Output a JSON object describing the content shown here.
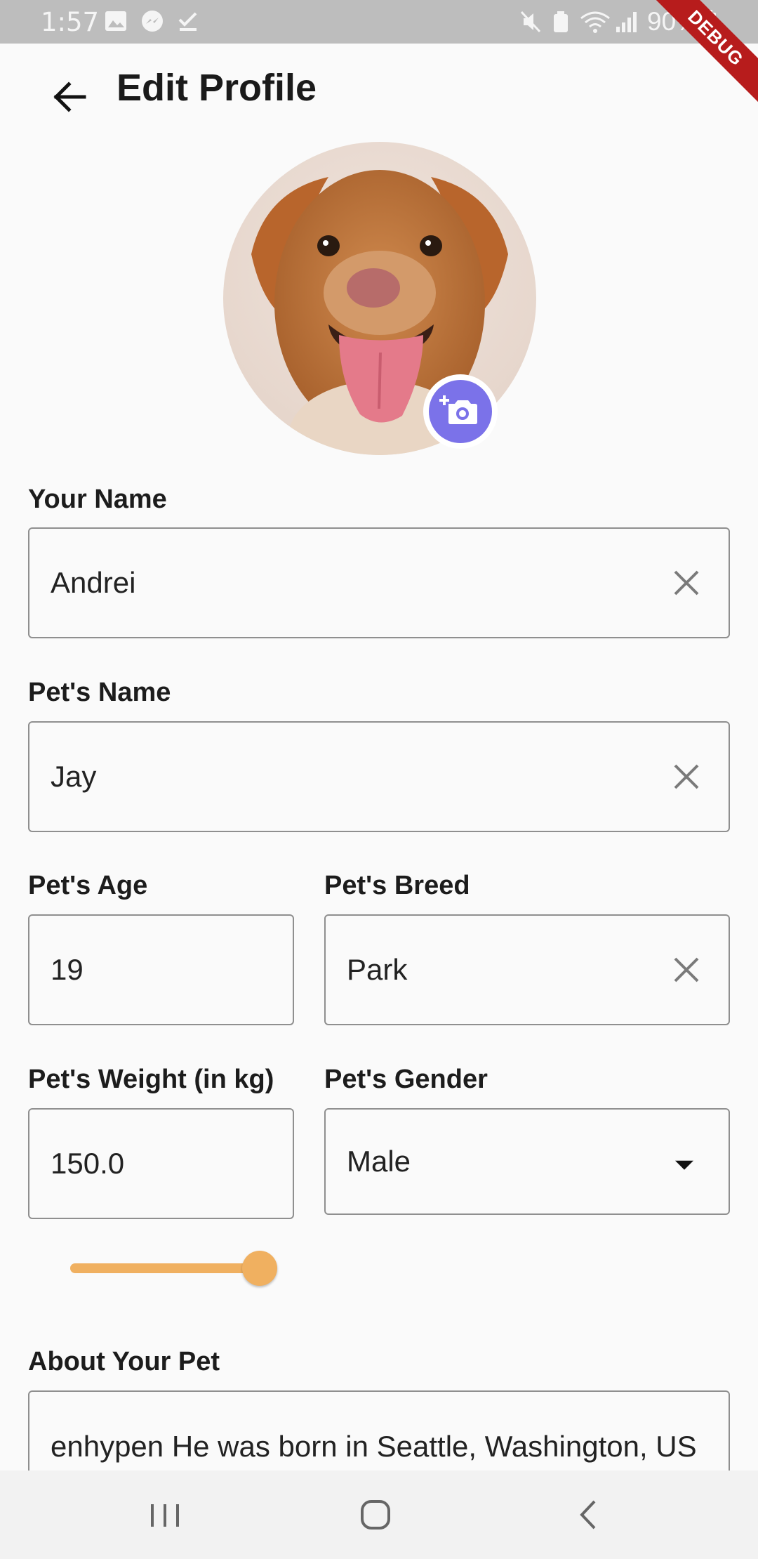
{
  "status_bar": {
    "time": "1:57",
    "battery": "90%"
  },
  "debug_banner": {
    "label": "DEBUG"
  },
  "app_bar": {
    "title": "Edit Profile"
  },
  "colors": {
    "accent": "#7b72e9",
    "slider": "#f0b060",
    "debug": "#b71c1c"
  },
  "form": {
    "your_name": {
      "label": "Your Name",
      "value": "Andrei"
    },
    "pet_name": {
      "label": "Pet's Name",
      "value": "Jay"
    },
    "pet_age": {
      "label": "Pet's Age",
      "value": "19"
    },
    "pet_breed": {
      "label": "Pet's Breed",
      "value": "Park"
    },
    "pet_weight": {
      "label": "Pet's Weight (in kg)",
      "value": "150.0",
      "slider_fraction": 1.0
    },
    "pet_gender": {
      "label": "Pet's Gender",
      "value": "Male"
    },
    "about": {
      "label": "About Your Pet",
      "value": "enhypen He was born in Seattle, Washington, US (always saying Seattle"
    }
  },
  "icons": {
    "back": "arrow-left-icon",
    "camera": "add-photo-icon",
    "clear": "close-icon",
    "dropdown": "caret-down-icon"
  }
}
